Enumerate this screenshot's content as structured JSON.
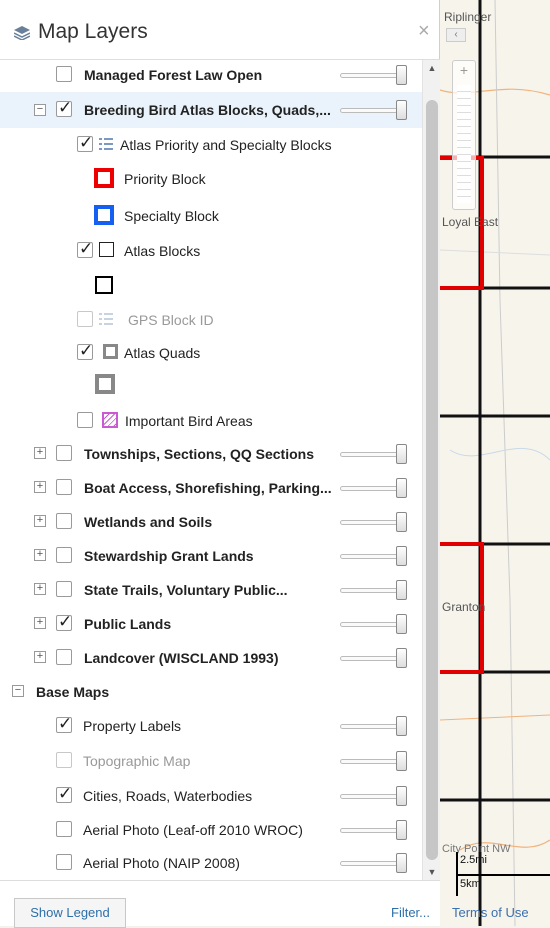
{
  "panel": {
    "title": "Map Layers",
    "close_label": "×",
    "show_legend_label": "Show Legend",
    "filter_label": "Filter..."
  },
  "layers": {
    "managed_forest": "Managed Forest Law Open",
    "breeding_bird": "Breeding Bird Atlas Blocks, Quads,...",
    "atlas_priority": "Atlas Priority and Specialty Blocks",
    "priority_block": "Priority Block",
    "specialty_block": "Specialty Block",
    "atlas_blocks": "Atlas Blocks",
    "gps_block": "GPS Block ID",
    "atlas_quads": "Atlas Quads",
    "important_bird": "Important Bird Areas",
    "townships": "Townships, Sections, QQ Sections",
    "boat_access": "Boat Access, Shorefishing, Parking...",
    "wetlands": "Wetlands and Soils",
    "stewardship": "Stewardship Grant Lands",
    "state_trails": "State Trails, Voluntary Public...",
    "public_lands": "Public Lands",
    "landcover": "Landcover (WISCLAND 1993)"
  },
  "base_maps": {
    "header": "Base Maps",
    "property_labels": "Property Labels",
    "topographic": "Topographic Map",
    "cities": "Cities, Roads, Waterbodies",
    "aerial_leafoff": "Aerial Photo (Leaf-off 2010 WROC)",
    "aerial_naip": "Aerial Photo (NAIP 2008)"
  },
  "map": {
    "town_ripinger": "Riplinger",
    "town_loyal_east": "Loyal East",
    "town_granton": "Granton",
    "town_city_point": "City Point NW",
    "scale_mi": "2.5mi",
    "scale_km": "5km",
    "terms": "Terms of Use"
  },
  "colors": {
    "priority": "#e00000",
    "specialty": "#1560f0",
    "link": "#2e6fa8"
  }
}
